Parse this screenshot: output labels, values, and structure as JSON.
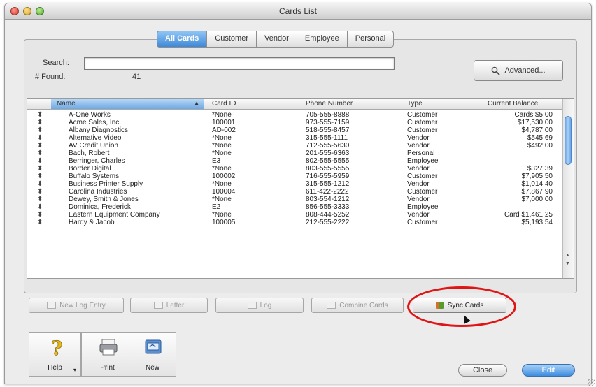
{
  "window": {
    "title": "Cards List"
  },
  "tabs": [
    "All Cards",
    "Customer",
    "Vendor",
    "Employee",
    "Personal"
  ],
  "active_tab": 0,
  "search": {
    "label": "Search:",
    "value": "",
    "found_label": "# Found:",
    "found_count": "41"
  },
  "advanced_button": {
    "label": "Advanced...",
    "icon": "magnifier-icon"
  },
  "columns": [
    "Name",
    "Card ID",
    "Phone Number",
    "Type",
    "Current Balance"
  ],
  "rows": [
    {
      "name": "A-One Works",
      "card_id": "*None",
      "phone": "705-555-8888",
      "type": "Customer",
      "balance": "Cards $5.00"
    },
    {
      "name": "Acme Sales, Inc.",
      "card_id": "100001",
      "phone": "973-555-7159",
      "type": "Customer",
      "balance": "$17,530.00"
    },
    {
      "name": "Albany Diagnostics",
      "card_id": "AD-002",
      "phone": "518-555-8457",
      "type": "Customer",
      "balance": "$4,787.00"
    },
    {
      "name": "Alternative Video",
      "card_id": "*None",
      "phone": "315-555-1111",
      "type": "Vendor",
      "balance": "$545.69"
    },
    {
      "name": "AV Credit Union",
      "card_id": "*None",
      "phone": "712-555-5630",
      "type": "Vendor",
      "balance": "$492.00"
    },
    {
      "name": "Bach, Robert",
      "card_id": "*None",
      "phone": "201-555-6363",
      "type": "Personal",
      "balance": ""
    },
    {
      "name": "Berringer, Charles",
      "card_id": "E3",
      "phone": "802-555-5555",
      "type": "Employee",
      "balance": ""
    },
    {
      "name": "Border Digital",
      "card_id": "*None",
      "phone": "803-555-5555",
      "type": "Vendor",
      "balance": "$327.39"
    },
    {
      "name": "Buffalo Systems",
      "card_id": "100002",
      "phone": "716-555-5959",
      "type": "Customer",
      "balance": "$7,905.50"
    },
    {
      "name": "Business Printer Supply",
      "card_id": "*None",
      "phone": "315-555-1212",
      "type": "Vendor",
      "balance": "$1,014.40"
    },
    {
      "name": "Carolina Industries",
      "card_id": "100004",
      "phone": "611-422-2222",
      "type": "Customer",
      "balance": "$7,867.90"
    },
    {
      "name": "Dewey, Smith & Jones",
      "card_id": "*None",
      "phone": "803-554-1212",
      "type": "Vendor",
      "balance": "$7,000.00"
    },
    {
      "name": "Dominica, Frederick",
      "card_id": "E2",
      "phone": "856-555-3333",
      "type": "Employee",
      "balance": ""
    },
    {
      "name": "Eastern Equipment Company",
      "card_id": "*None",
      "phone": "808-444-5252",
      "type": "Vendor",
      "balance": "Card $1,461.25"
    },
    {
      "name": "Hardy & Jacob",
      "card_id": "100005",
      "phone": "212-555-2222",
      "type": "Customer",
      "balance": "$5,193.54"
    }
  ],
  "action_buttons": [
    {
      "label": "New Log Entry",
      "name": "new-log-entry-button",
      "enabled": false
    },
    {
      "label": "Letter",
      "name": "letter-button",
      "enabled": false
    },
    {
      "label": "Log",
      "name": "log-button",
      "enabled": false
    },
    {
      "label": "Combine Cards",
      "name": "combine-cards-button",
      "enabled": false
    },
    {
      "label": "Sync Cards",
      "name": "sync-cards-button",
      "enabled": true
    }
  ],
  "toolbar": [
    {
      "label": "Help",
      "icon": "help-question-icon"
    },
    {
      "label": "Print",
      "icon": "printer-icon"
    },
    {
      "label": "New",
      "icon": "new-card-icon"
    }
  ],
  "bottom_buttons": {
    "close": "Close",
    "edit": "Edit"
  },
  "colors": {
    "accent_blue": "#3f89d8",
    "highlight_red": "#e01515"
  }
}
